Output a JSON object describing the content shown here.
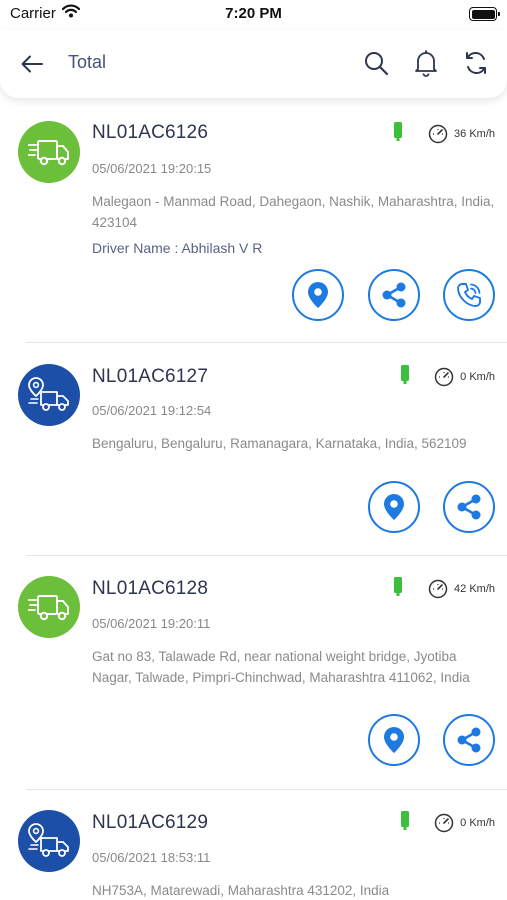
{
  "status_bar": {
    "carrier": "Carrier",
    "time": "7:20 PM"
  },
  "header": {
    "title": "Total"
  },
  "colors": {
    "accent": "#1d7ae0",
    "moving": "#6cbf3a",
    "stopped": "#1c4fa8",
    "battery": "#3cbf3c"
  },
  "vehicles": [
    {
      "plate": "NL01AC6126",
      "datetime": "05/06/2021 19:20:15",
      "address": "Malegaon - Manmad Road, Dahegaon, Nashik, Maharashtra, India, 423104",
      "driver": "Driver Name : Abhilash V R",
      "speed": "36 Km/h",
      "status": "moving",
      "icon": "delivery-truck-icon",
      "actions": [
        "location-icon",
        "share-icon",
        "call-icon"
      ]
    },
    {
      "plate": "NL01AC6127",
      "datetime": "05/06/2021 19:12:54",
      "address": "Bengaluru, Bengaluru, Ramanagara, Karnataka, India, 562109",
      "speed": "0 Km/h",
      "status": "stopped",
      "icon": "truck-location-icon",
      "actions": [
        "location-icon",
        "share-icon"
      ]
    },
    {
      "plate": "NL01AC6128",
      "datetime": "05/06/2021 19:20:11",
      "address": "Gat no 83, Talawade Rd, near national weight bridge, Jyotiba Nagar, Talwade, Pimpri-Chinchwad, Maharashtra 411062, India",
      "speed": "42 Km/h",
      "status": "moving",
      "icon": "delivery-truck-icon",
      "actions": [
        "location-icon",
        "share-icon"
      ]
    },
    {
      "plate": "NL01AC6129",
      "datetime": "05/06/2021 18:53:11",
      "address": "NH753A, Matarewadi, Maharashtra 431202, India",
      "speed": "0 Km/h",
      "status": "stopped",
      "icon": "truck-location-icon",
      "actions": []
    }
  ]
}
